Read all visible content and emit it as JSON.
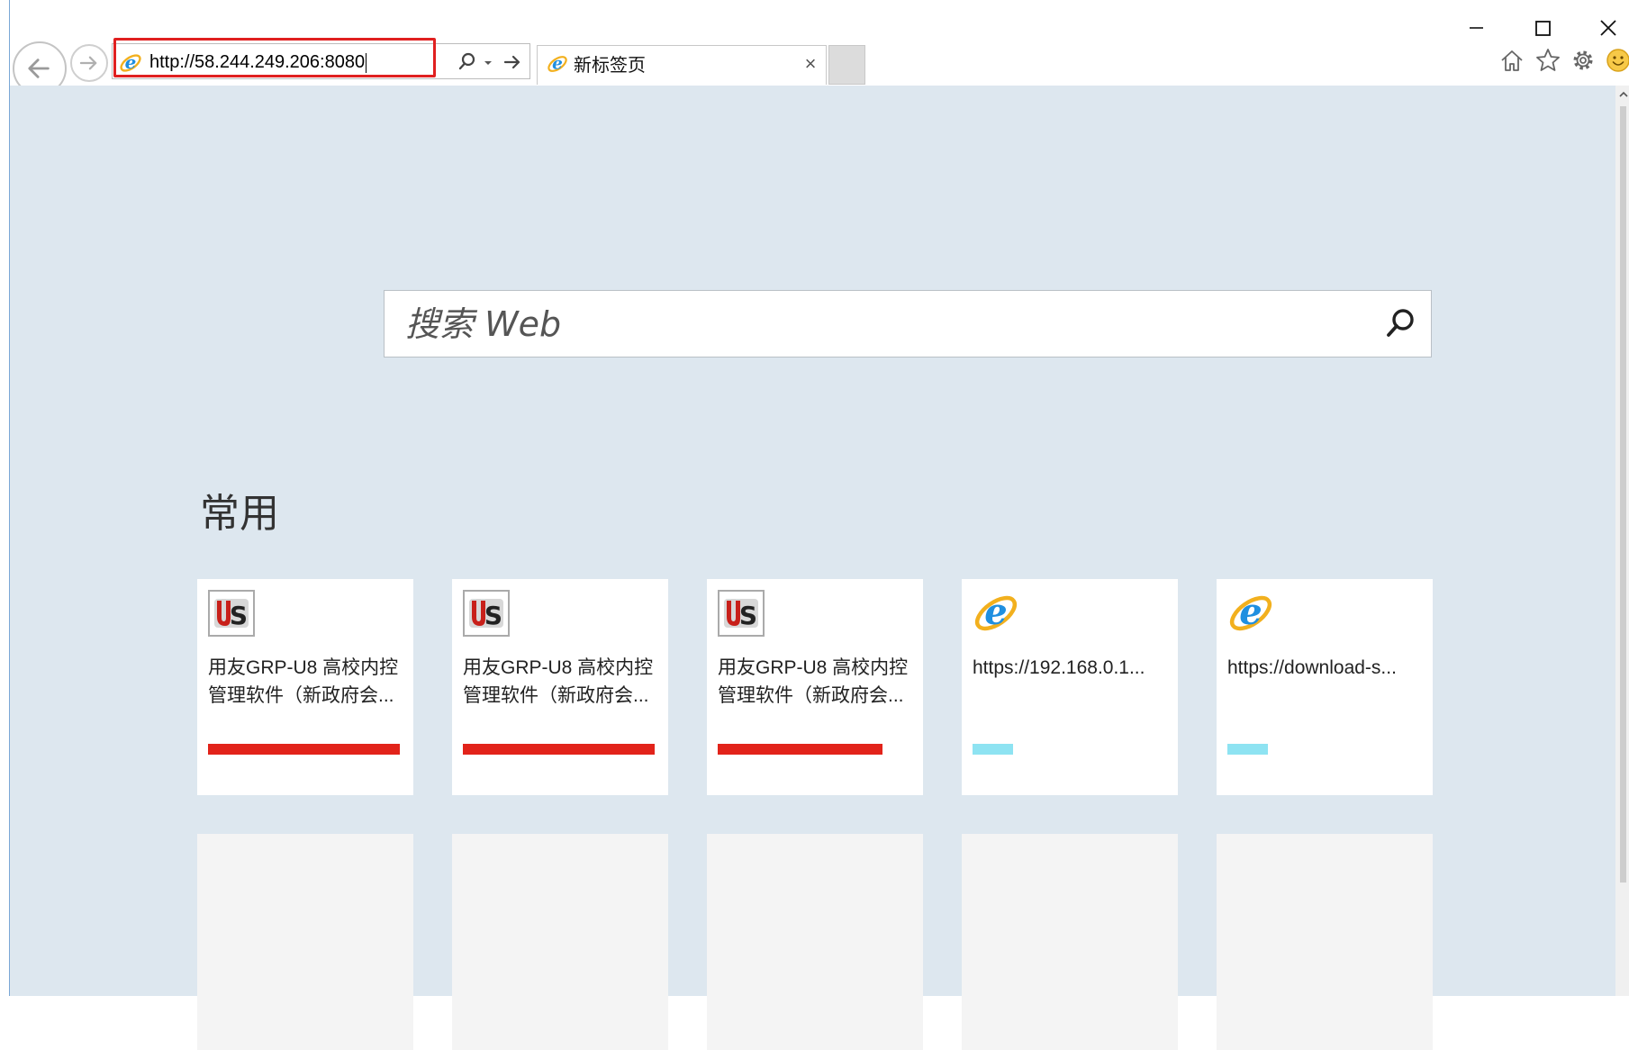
{
  "browser": {
    "address_url": "http://58.244.249.206:8080",
    "tab_title": "新标签页",
    "tab_close": "×"
  },
  "search": {
    "placeholder": "搜索 Web"
  },
  "frequent": {
    "title": "常用",
    "tiles": [
      {
        "icon": "yonyou-logo-icon",
        "line1": "用友GRP-U8 高校内控",
        "line2": "管理软件（新政府会...",
        "bar_color": "#e2231a",
        "bar_fill": 1.0
      },
      {
        "icon": "yonyou-logo-icon",
        "line1": "用友GRP-U8 高校内控",
        "line2": "管理软件（新政府会...",
        "bar_color": "#e2231a",
        "bar_fill": 1.0
      },
      {
        "icon": "yonyou-logo-icon",
        "line1": "用友GRP-U8 高校内控",
        "line2": "管理软件（新政府会...",
        "bar_color": "#e2231a",
        "bar_fill": 0.86
      },
      {
        "icon": "ie-icon",
        "line1": "https://192.168.0.1...",
        "line2": "",
        "bar_color": "#8ee3f2",
        "bar_fill": 0.21
      },
      {
        "icon": "ie-icon",
        "line1": "https://download-s...",
        "line2": "",
        "bar_color": "#8ee3f2",
        "bar_fill": 0.21
      }
    ]
  },
  "colors": {
    "content_bg": "#dde7ef",
    "focus_border": "#e02020"
  }
}
